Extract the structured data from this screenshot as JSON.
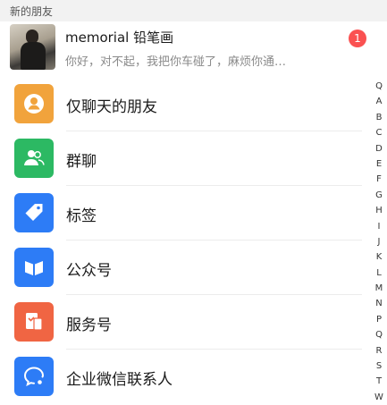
{
  "new_friends": {
    "header": "新的朋友",
    "request": {
      "name": "memorial 铅笔画",
      "message": "你好，对不起，我把你车碰了，麻烦你通…",
      "badge": "1"
    }
  },
  "menu_items": [
    {
      "label": "仅聊天的朋友",
      "icon": "person-icon",
      "color": "#f1a33c"
    },
    {
      "label": "群聊",
      "icon": "group-chat-icon",
      "color": "#2cb963"
    },
    {
      "label": "标签",
      "icon": "tag-icon",
      "color": "#2d7cf6"
    },
    {
      "label": "公众号",
      "icon": "official-account-icon",
      "color": "#2d7cf6"
    },
    {
      "label": "服务号",
      "icon": "service-account-icon",
      "color": "#f06543"
    },
    {
      "label": "企业微信联系人",
      "icon": "work-contacts-icon",
      "color": "#2d7cf6"
    }
  ],
  "index_bar": [
    "Q",
    "A",
    "B",
    "C",
    "D",
    "E",
    "F",
    "G",
    "H",
    "I",
    "J",
    "K",
    "L",
    "M",
    "N",
    "P",
    "Q",
    "R",
    "S",
    "T",
    "W"
  ]
}
